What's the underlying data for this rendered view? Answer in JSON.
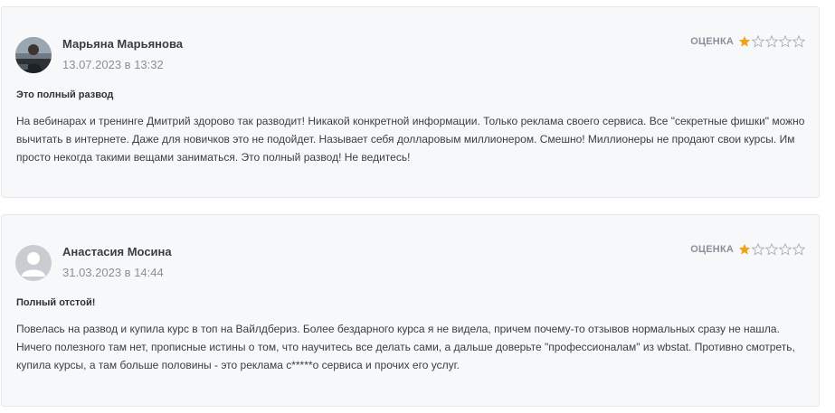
{
  "reviews": [
    {
      "author": "Марьяна Марьянова",
      "date": "13.07.2023 в 13:32",
      "rating_label": "ОЦЕНКА",
      "rating": 1,
      "rating_max": 5,
      "title": "Это полный развод",
      "text": "На вебинарах и тренинге Дмитрий здорово так разводит! Никакой конкретной информации. Только реклама своего сервиса. Все \"секретные фишки\" можно вычитать в интернете. Даже для новичков это не подойдет. Называет себя долларовым миллионером. Смешно! Миллионеры не продают свои курсы. Им просто некогда такими вещами заниматься. Это полный развод! Не ведитесь!"
    },
    {
      "author": "Анастасия Мосина",
      "date": "31.03.2023 в 14:44",
      "rating_label": "ОЦЕНКА",
      "rating": 1,
      "rating_max": 5,
      "title": "Полный отстой!",
      "text": "Повелась на развод и купила курс в топ на Вайлдбериз. Более бездарного курса я не видела, причем почему-то отзывов нормальных сразу не нашла. Ничего полезного там нет, прописные истины о том, что научитесь все делать сами, а дальше доверьте \"профессионалам\" из wbstat. Противно смотреть, купила курсы, а там больше половины - это реклама с*****о сервиса и прочих его услуг."
    }
  ],
  "colors": {
    "star_filled": "#f0a21b",
    "star_empty_stroke": "#a9adb5",
    "card_bg": "#f7f8fa"
  }
}
